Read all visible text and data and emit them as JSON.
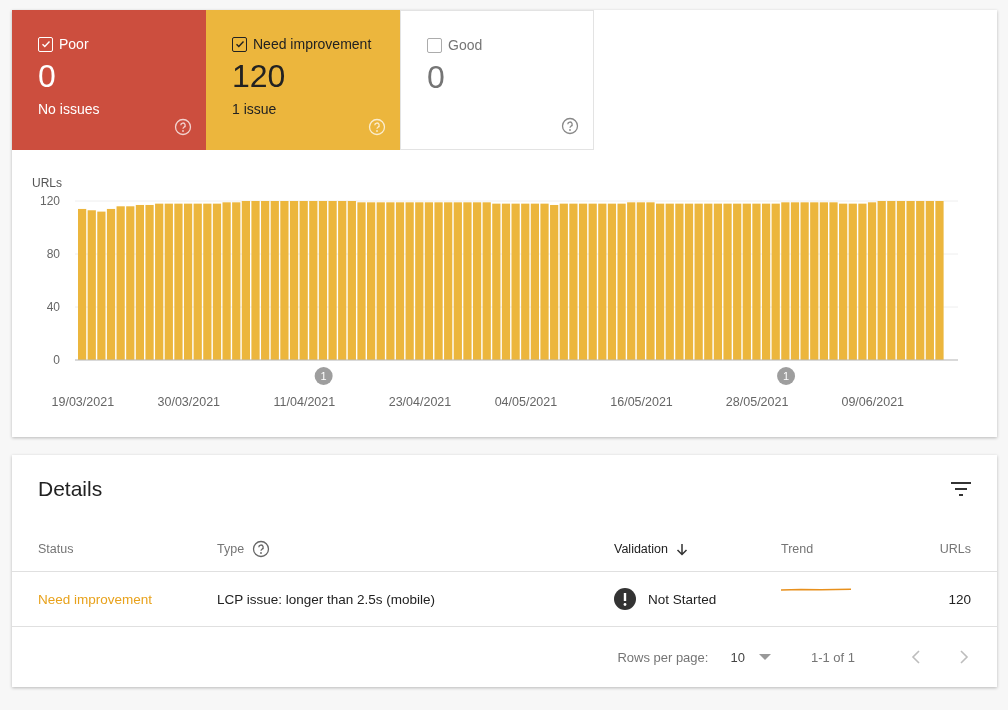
{
  "summary_tiles": [
    {
      "label": "Poor",
      "checked": true,
      "color": "#cc4e3e",
      "value": "0",
      "caption": "No issues"
    },
    {
      "label": "Need improvement",
      "checked": true,
      "color": "#ecb63d",
      "value": "120",
      "caption": "1 issue"
    },
    {
      "label": "Good",
      "checked": false,
      "value": "0"
    }
  ],
  "chart": {
    "chart_data": {
      "type": "bar",
      "ylabel": "URLs",
      "ylim": [
        0,
        120
      ],
      "yticks": [
        0,
        40,
        80,
        120
      ],
      "categories": [
        "19/03/2021",
        null,
        null,
        null,
        null,
        null,
        null,
        null,
        null,
        null,
        null,
        "30/03/2021",
        null,
        null,
        null,
        null,
        null,
        null,
        null,
        null,
        null,
        null,
        null,
        "11/04/2021",
        null,
        null,
        null,
        null,
        null,
        null,
        null,
        null,
        null,
        null,
        null,
        "23/04/2021",
        null,
        null,
        null,
        null,
        null,
        null,
        null,
        null,
        null,
        null,
        "04/05/2021",
        null,
        null,
        null,
        null,
        null,
        null,
        null,
        null,
        null,
        null,
        null,
        "16/05/2021",
        null,
        null,
        null,
        null,
        null,
        null,
        null,
        null,
        null,
        null,
        null,
        "28/05/2021",
        null,
        null,
        null,
        null,
        null,
        null,
        null,
        null,
        null,
        null,
        null,
        "09/06/2021",
        null,
        null,
        null,
        null,
        null,
        null,
        null
      ],
      "series": [
        {
          "color": "#ecb63d",
          "values": [
            114,
            113,
            112,
            114,
            116,
            116,
            117,
            117,
            118,
            118,
            118,
            118,
            118,
            118,
            118,
            119,
            119,
            120,
            120,
            120,
            120,
            120,
            120,
            120,
            120,
            120,
            120,
            120,
            120,
            119,
            119,
            119,
            119,
            119,
            119,
            119,
            119,
            119,
            119,
            119,
            119,
            119,
            119,
            118,
            118,
            118,
            118,
            118,
            118,
            117,
            118,
            118,
            118,
            118,
            118,
            118,
            118,
            119,
            119,
            119,
            118,
            118,
            118,
            118,
            118,
            118,
            118,
            118,
            118,
            118,
            118,
            118,
            118,
            119,
            119,
            119,
            119,
            119,
            119,
            118,
            118,
            118,
            119,
            120,
            120,
            120,
            120,
            120,
            120,
            120
          ]
        }
      ]
    },
    "event_markers": [
      {
        "label": "1"
      },
      {
        "label": "1"
      }
    ]
  },
  "details": {
    "title": "Details",
    "columns": [
      {
        "label": "Status",
        "sorted": false,
        "help": false
      },
      {
        "label": "Type",
        "sorted": false,
        "help": true
      },
      {
        "label": "Validation",
        "sorted": true,
        "help": false
      },
      {
        "label": "Trend",
        "sorted": false,
        "help": false
      },
      {
        "label": "URLs",
        "sorted": false,
        "help": false
      }
    ],
    "rows": [
      {
        "status": "Need improvement",
        "color": "#e8a21c",
        "type": "LCP issue: longer than 2.5s (mobile)",
        "validation": "Not Started",
        "urls": "120"
      }
    ],
    "pagination": {
      "rows_per_page_label": "Rows per page:",
      "rows_per_page": "10",
      "range": "1-1 of 1",
      "prev_disabled": true,
      "next_disabled": true
    }
  }
}
